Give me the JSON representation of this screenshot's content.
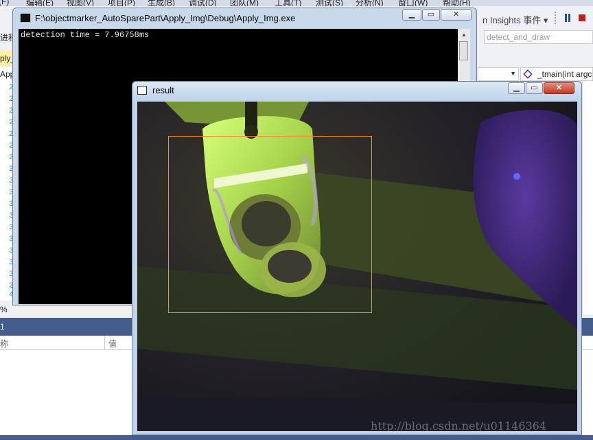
{
  "vs": {
    "menu": [
      "(F)",
      "编辑(E)",
      "视图(V)",
      "项目(P)",
      "生成(B)",
      "调试(D)",
      "团队(M)",
      "工具(T)",
      "测试(S)",
      "分析(N)",
      "窗口(W)",
      "帮助(H)"
    ],
    "left_label": "进程:",
    "tab_label": "ply_I",
    "tab2_label": "App",
    "line_numbers": [
      "2",
      "2",
      "2",
      "2",
      "2",
      "2",
      "2",
      "2",
      "3",
      "3",
      "3",
      "3",
      "3",
      "3",
      "3",
      "3",
      "3",
      "3",
      "4"
    ],
    "insights_label": "n Insights 事件 ▾",
    "search_value": "detect_and_draw",
    "method_combo": "_tmain(int argc",
    "zoom_pct": "%",
    "panel_title": "1",
    "grid_col_name": "称",
    "grid_col_value": "值"
  },
  "console": {
    "title": "F:\\objectmarker_AutoSparePart\\Apply_Img\\Debug\\Apply_Img.exe",
    "output": "detection time = 7.96758ms"
  },
  "result": {
    "title": "result",
    "watermark": "http://blog.csdn.net/u01146364"
  },
  "colors": {
    "detection_box": "#ff8a1e",
    "vs_accent": "#425d8c",
    "console_bg": "#000000"
  },
  "icons": [
    "minimize-icon",
    "maximize-icon",
    "close-icon",
    "pause-icon",
    "stop-icon",
    "method-icon"
  ]
}
